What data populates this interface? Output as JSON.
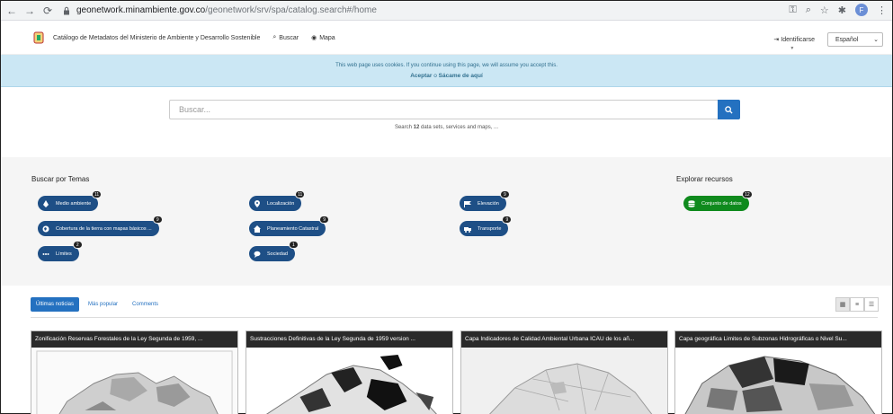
{
  "browser": {
    "url_domain": "geonetwork.minambiente.gov.co",
    "url_path": "/geonetwork/srv/spa/catalog.search#/home",
    "profile_initial": "F"
  },
  "header": {
    "title": "Catálogo de Metadatos del Ministerio de Ambiente y Desarrollo Sostenible",
    "search_link": "Buscar",
    "map_link": "Mapa",
    "identify": "Identificarse",
    "language": "Español"
  },
  "cookie": {
    "message": "This web page uses cookies. If you continue using this page, we will assume you accept this.",
    "accept": "Aceptar",
    "separator": "o",
    "leave": "Sácame de aquí"
  },
  "search": {
    "placeholder": "Buscar...",
    "sub_prefix": "Search ",
    "sub_count": "12",
    "sub_suffix": " data sets, services and maps, ..."
  },
  "topics": {
    "title": "Buscar por Temas",
    "explore_title": "Explorar recursos",
    "items": [
      {
        "label": "Medio ambiente",
        "count": "11",
        "icon": "leaf-icon"
      },
      {
        "label": "Localización",
        "count": "11",
        "icon": "map-marker-icon"
      },
      {
        "label": "Elevación",
        "count": "9",
        "icon": "flag-icon"
      },
      {
        "label": "Cobertura de la tierra con mapas básicos ...",
        "count": "9",
        "icon": "globe-icon"
      },
      {
        "label": "Planeamiento Catastral",
        "count": "9",
        "icon": "home-icon"
      },
      {
        "label": "Transporte",
        "count": "9",
        "icon": "truck-icon"
      },
      {
        "label": "Límites",
        "count": "2",
        "icon": "dots-icon"
      },
      {
        "label": "Sociedad",
        "count": "1",
        "icon": "comments-icon"
      }
    ],
    "resource": {
      "label": "Conjunto de datos",
      "count": "12",
      "icon": "database-icon"
    }
  },
  "tabs": [
    "Últimas noticias",
    "Más popular",
    "Comments"
  ],
  "cards": [
    "Zonificación Reservas Forestales de la Ley Segunda de 1959, ...",
    "Sustracciones Definitivas de la Ley Segunda de 1959 version ...",
    "Capa Indicadores de Calidad Ambiental Urbana ICAU de los añ...",
    "Capa geográfica Limites de Subzonas Hidrográficas o Nivel Su..."
  ],
  "colors": {
    "primary": "#2471c0",
    "pill": "#1e4f86",
    "green": "#0f8a1d",
    "cookie_bg": "#cbe7f4"
  }
}
